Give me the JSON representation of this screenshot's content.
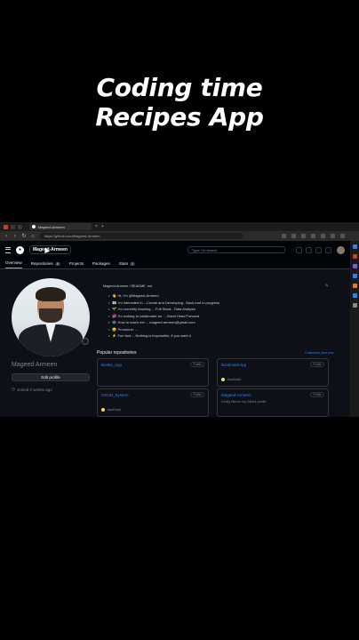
{
  "caption": {
    "line1": "Coding time",
    "line2": "Recipes App"
  },
  "browser": {
    "tab_title": "Mageed-Armeen",
    "url": "https://github.com/Mageed-Armeen"
  },
  "header": {
    "username": "Mageed-Armeen",
    "search_placeholder": "Type / to search"
  },
  "tabs": [
    {
      "label": "Overview",
      "count": ""
    },
    {
      "label": "Repositories",
      "count": "8"
    },
    {
      "label": "Projects",
      "count": ""
    },
    {
      "label": "Packages",
      "count": ""
    },
    {
      "label": "Stars",
      "count": "2"
    }
  ],
  "profile": {
    "display_name": "Mageed Armeen",
    "edit_label": "Edit profile",
    "joined": "Joined 2 weeks ago"
  },
  "readme": {
    "path": "Mageed-Armeen / README .md",
    "lines": [
      "👋 Hi, I'm @Mageed-Armeen",
      "👀 I'm interested in ...Create and Developing , Back-end in progress",
      "🌱 I'm currently learning ... Full Stack , Data Analysis",
      "💞️ I'm looking to collaborate on ....Great Head Forward",
      "📫 How to reach me ... mageed.armeen@gmail.com",
      "😄 Pronouns: ...",
      "⚡ Fun fact: ...Nothing is impossible, if you want it"
    ]
  },
  "popular": {
    "title": "Popular repositories",
    "customize": "Customize your pins",
    "repos": [
      {
        "name": "Books_App",
        "badge": "Public",
        "desc": "",
        "lang": ""
      },
      {
        "name": "BookmarkApp",
        "badge": "Public",
        "desc": "",
        "lang": "JavaScript"
      },
      {
        "name": "CRUD_System",
        "badge": "Public",
        "desc": "",
        "lang": "JavaScript"
      },
      {
        "name": "Mageed-Armeen",
        "badge": "Public",
        "desc": "Config files for my GitHub profile.",
        "lang": ""
      }
    ]
  },
  "colors": {
    "accent_link": "#2f81f7",
    "tab_underline": "#f78166",
    "js_lang": "#f1e05a"
  }
}
